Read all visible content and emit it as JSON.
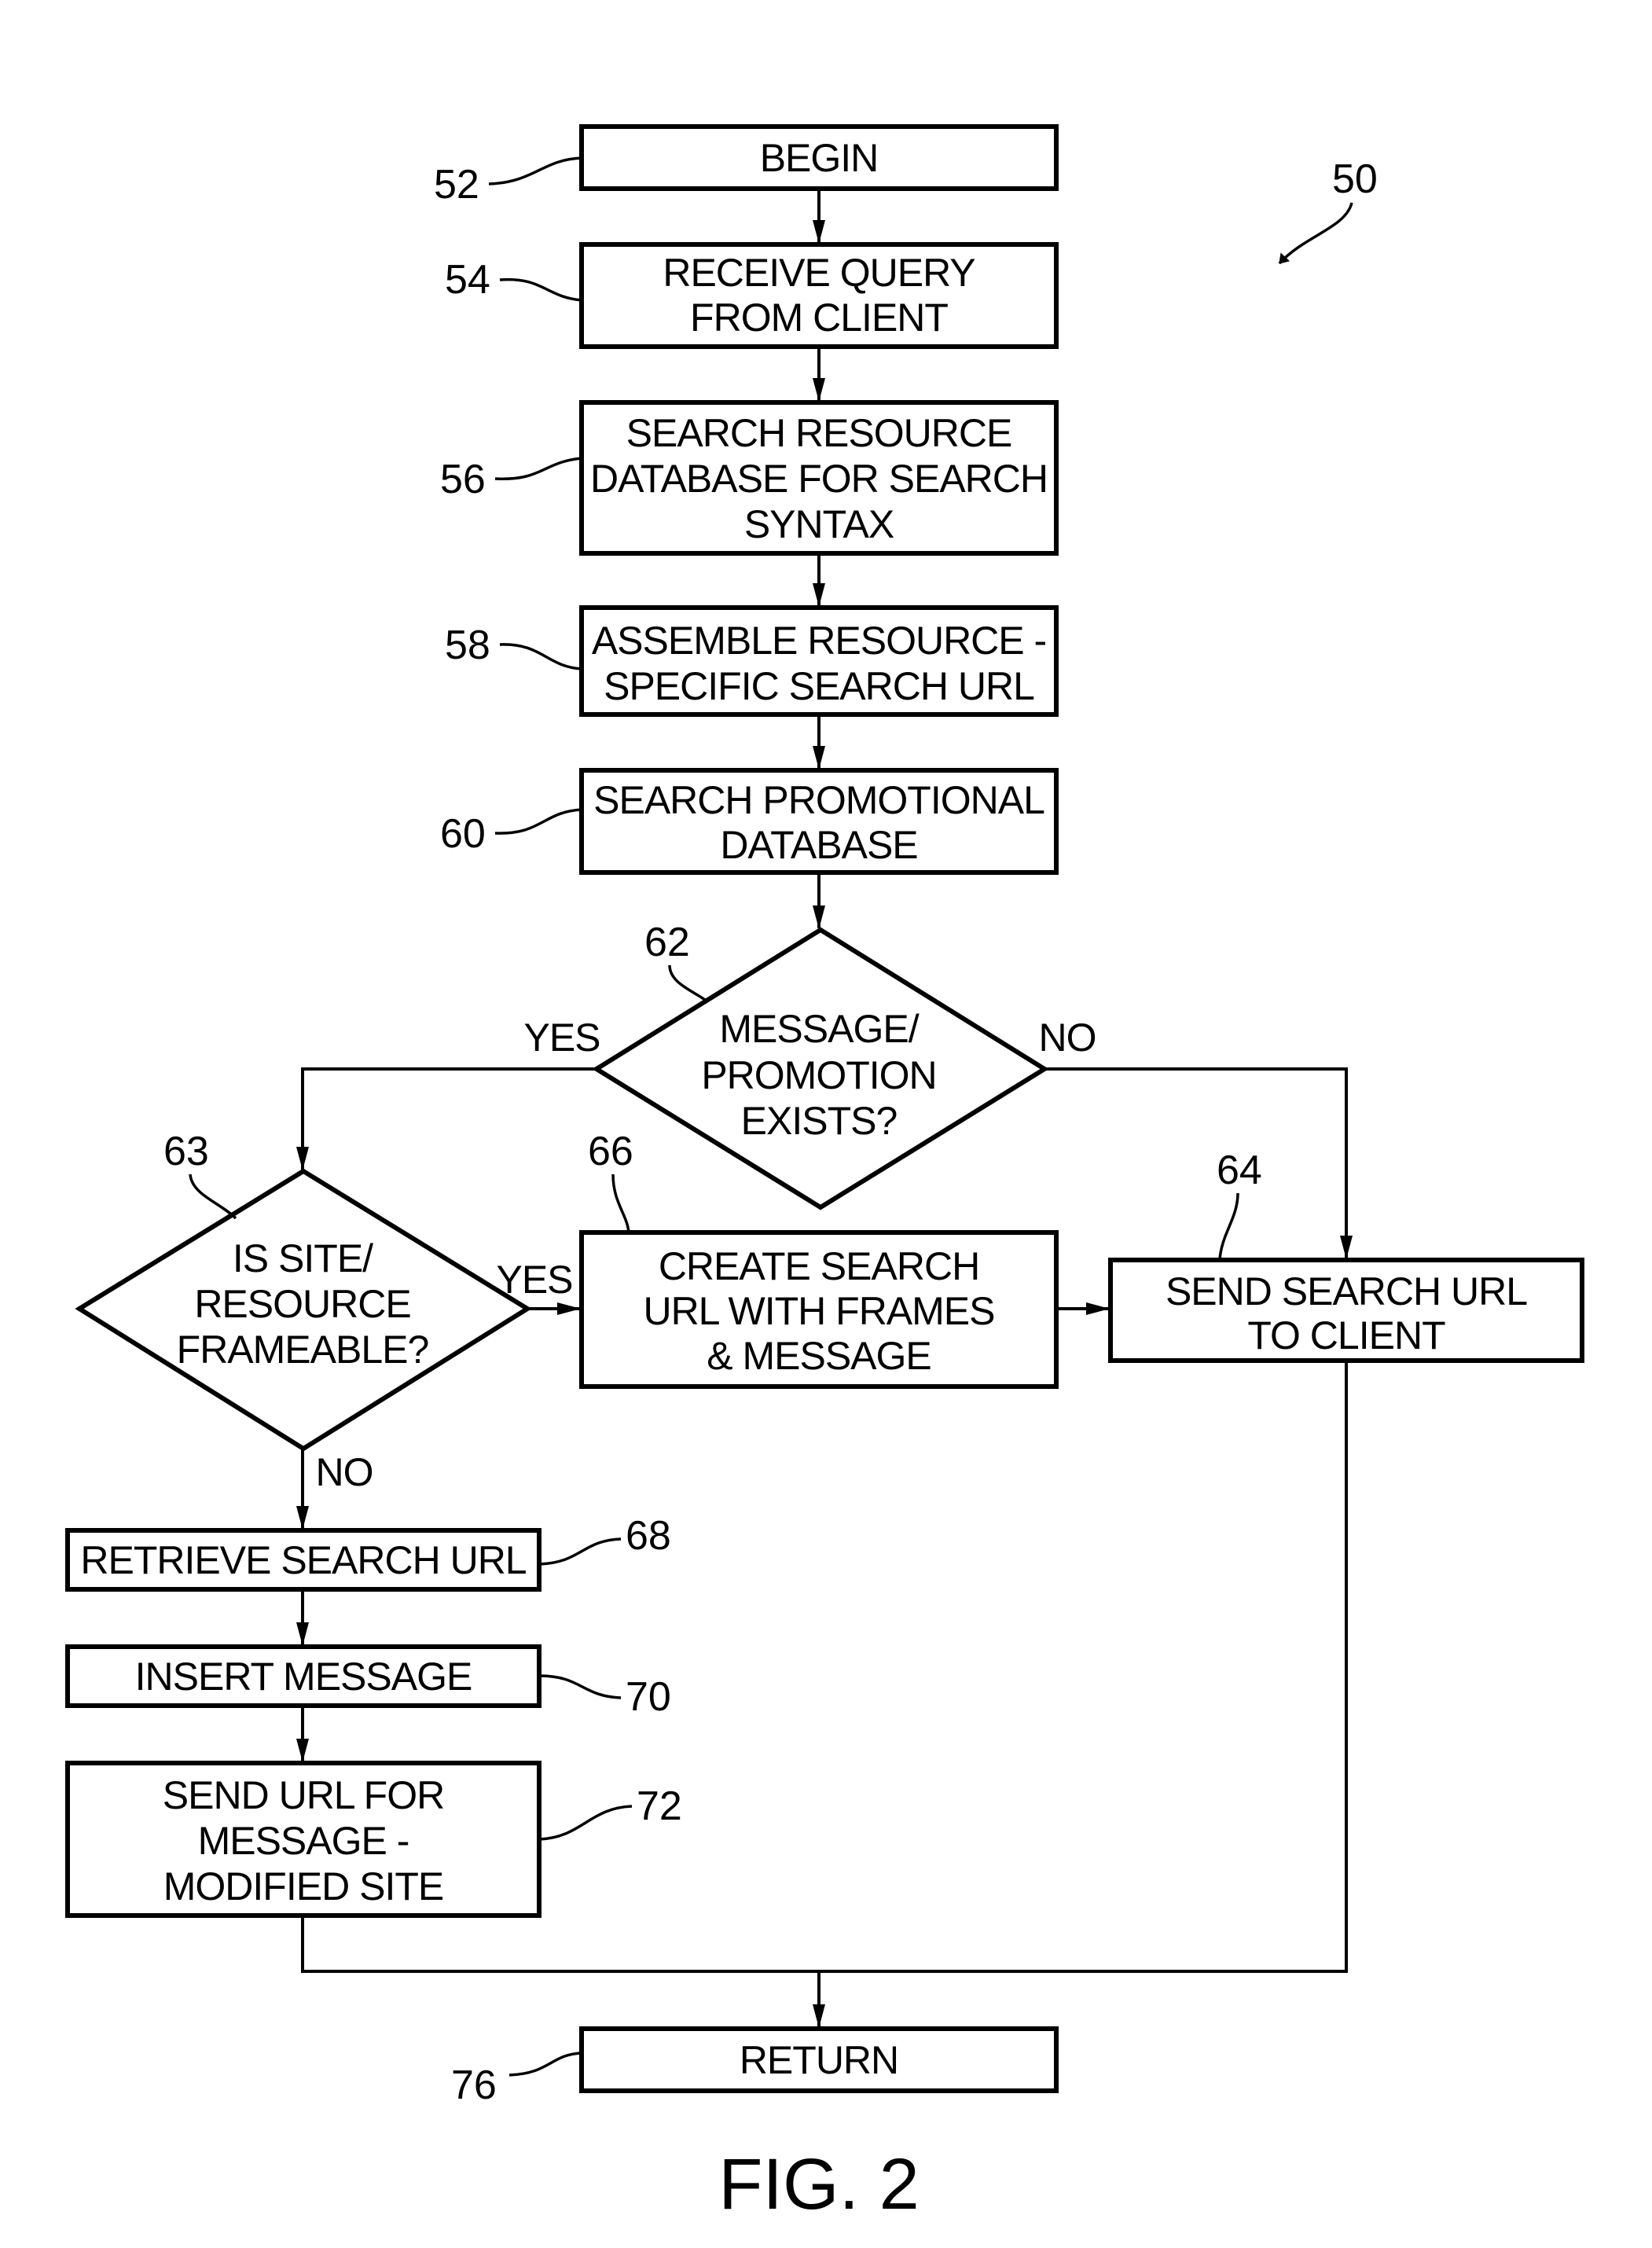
{
  "figure": {
    "caption": "FIG. 2",
    "reference": "50"
  },
  "nodes": {
    "n52": {
      "ref": "52",
      "lines": [
        "BEGIN"
      ]
    },
    "n54": {
      "ref": "54",
      "lines": [
        "RECEIVE QUERY",
        "FROM CLIENT"
      ]
    },
    "n56": {
      "ref": "56",
      "lines": [
        "SEARCH RESOURCE",
        "DATABASE FOR SEARCH",
        "SYNTAX"
      ]
    },
    "n58": {
      "ref": "58",
      "lines": [
        "ASSEMBLE RESOURCE -",
        "SPECIFIC SEARCH URL"
      ]
    },
    "n60": {
      "ref": "60",
      "lines": [
        "SEARCH PROMOTIONAL",
        "DATABASE"
      ]
    },
    "n62": {
      "ref": "62",
      "lines": [
        "MESSAGE/",
        "PROMOTION",
        "EXISTS?"
      ]
    },
    "n63": {
      "ref": "63",
      "lines": [
        "IS SITE/",
        "RESOURCE",
        "FRAMEABLE?"
      ]
    },
    "n66": {
      "ref": "66",
      "lines": [
        "CREATE SEARCH",
        "URL WITH FRAMES",
        "& MESSAGE"
      ]
    },
    "n64": {
      "ref": "64",
      "lines": [
        "SEND SEARCH URL",
        "TO CLIENT"
      ]
    },
    "n68": {
      "ref": "68",
      "lines": [
        "RETRIEVE SEARCH URL"
      ]
    },
    "n70": {
      "ref": "70",
      "lines": [
        "INSERT MESSAGE"
      ]
    },
    "n72": {
      "ref": "72",
      "lines": [
        "SEND URL FOR",
        "MESSAGE -",
        "MODIFIED SITE"
      ]
    },
    "n76": {
      "ref": "76",
      "lines": [
        "RETURN"
      ]
    }
  },
  "edge_labels": {
    "n62_yes": "YES",
    "n62_no": "NO",
    "n63_yes": "YES",
    "n63_no": "NO"
  }
}
